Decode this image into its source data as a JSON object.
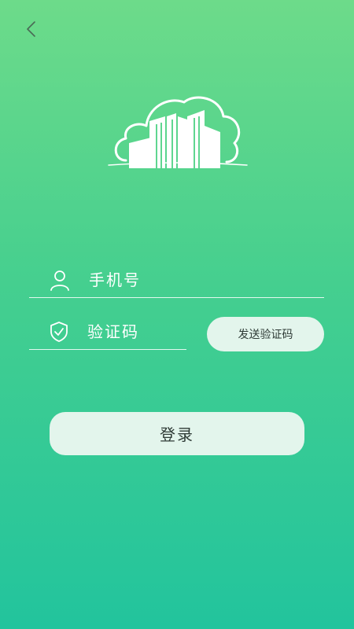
{
  "header": {
    "back_icon": "chevron-left-icon"
  },
  "logo": {
    "icon": "cloud-building-logo"
  },
  "form": {
    "phone_icon": "user-icon",
    "phone_placeholder": "手机号",
    "phone_value": "",
    "code_icon": "shield-check-icon",
    "code_placeholder": "验证码",
    "code_value": "",
    "send_code_label": "发送验证码",
    "login_label": "登录"
  },
  "colors": {
    "gradient_top": "#6ddb8a",
    "gradient_bottom": "#22c49d",
    "button_bg": "#e3f5ec",
    "button_text": "#2f3b36"
  }
}
